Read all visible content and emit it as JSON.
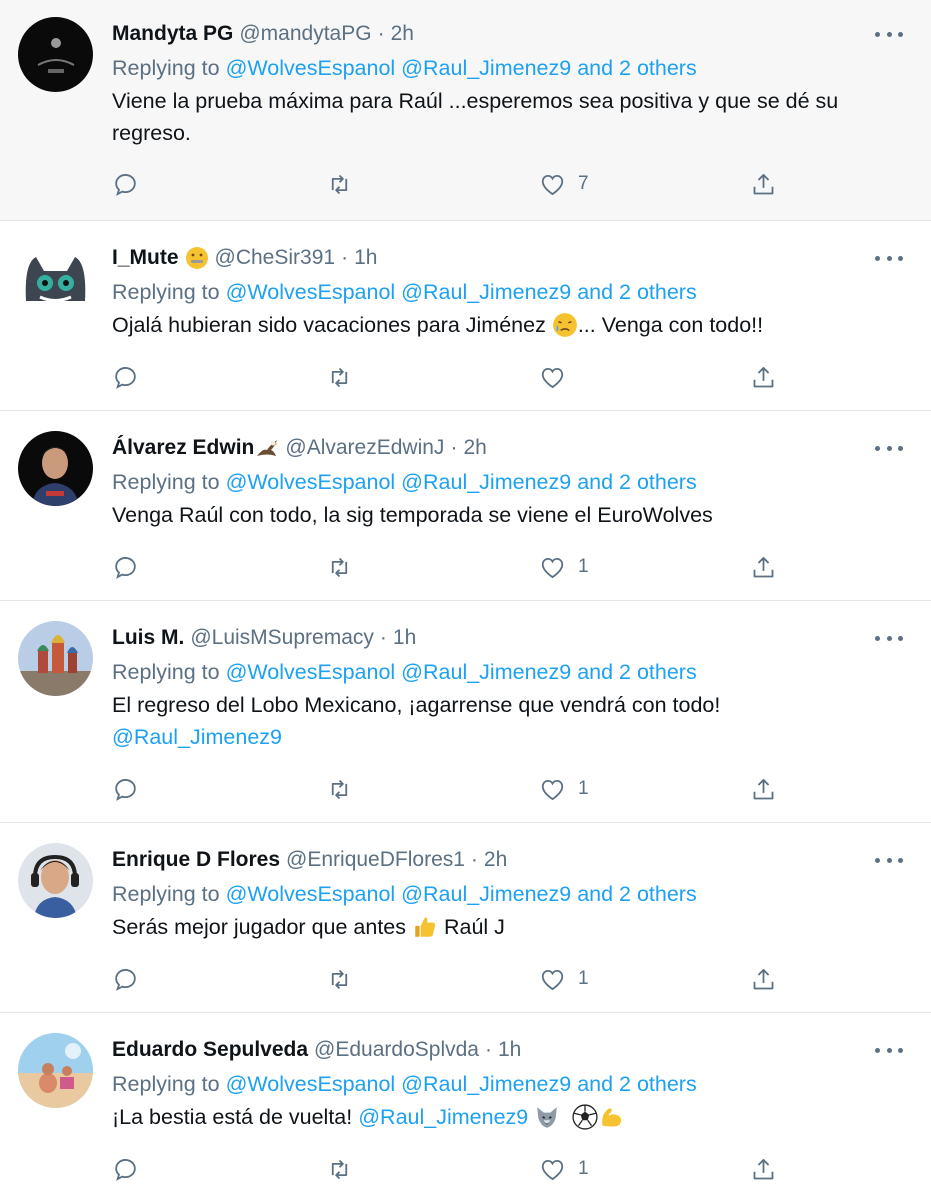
{
  "reply_prefix": "Replying to",
  "tweets": [
    {
      "name": "Mandyta PG",
      "handle": "@mandytaPG",
      "time": "2h",
      "mentions": [
        "@WolvesEspanol",
        "@Raul_Jimenez9"
      ],
      "others": "and 2 others",
      "body": "Viene la prueba máxima para Raúl ...esperemos sea positiva y que se dé su regreso.",
      "likes": "7",
      "highlighted": true
    },
    {
      "name": "I_Mute",
      "name_emoji": "zipper-mouth-face-emoji",
      "handle": "@CheSir391",
      "time": "1h",
      "mentions": [
        "@WolvesEspanol",
        "@Raul_Jimenez9"
      ],
      "others": "and 2 others",
      "body": "Ojalá hubieran sido vacaciones para Jiménez",
      "body_emoji": "sad-relieved-face-emoji",
      "body_tail": "... Venga con todo!!",
      "likes": ""
    },
    {
      "name": "Álvarez Edwin",
      "name_emoji": "eagle-emoji",
      "handle": "@AlvarezEdwinJ",
      "time": "2h",
      "mentions": [
        "@WolvesEspanol",
        "@Raul_Jimenez9"
      ],
      "others": "and 2 others",
      "body": "Venga Raúl con todo, la sig temporada se viene el EuroWolves",
      "likes": "1"
    },
    {
      "name": "Luis M.",
      "handle": "@LuisMSupremacy",
      "time": "1h",
      "mentions": [
        "@WolvesEspanol",
        "@Raul_Jimenez9"
      ],
      "others": "and 2 others",
      "body": "El regreso del Lobo Mexicano, ¡agarrense que vendrá con todo!",
      "body_mention": "@Raul_Jimenez9",
      "likes": "1"
    },
    {
      "name": "Enrique D Flores",
      "handle": "@EnriqueDFlores1",
      "time": "2h",
      "mentions": [
        "@WolvesEspanol",
        "@Raul_Jimenez9"
      ],
      "others": "and 2 others",
      "body": "Serás mejor jugador que antes",
      "body_emoji": "thumbs-up-emoji",
      "body_tail": "Raúl J",
      "likes": "1"
    },
    {
      "name": "Eduardo Sepulveda",
      "handle": "@EduardoSplvda",
      "time": "1h",
      "mentions": [
        "@WolvesEspanol",
        "@Raul_Jimenez9"
      ],
      "others": "and 2 others",
      "body": "¡La bestia está de vuelta!",
      "body_mention": "@Raul_Jimenez9",
      "body_emojis": [
        "wolf-emoji",
        "soccer-ball-emoji",
        "flexed-biceps-emoji"
      ],
      "likes": "1"
    }
  ]
}
